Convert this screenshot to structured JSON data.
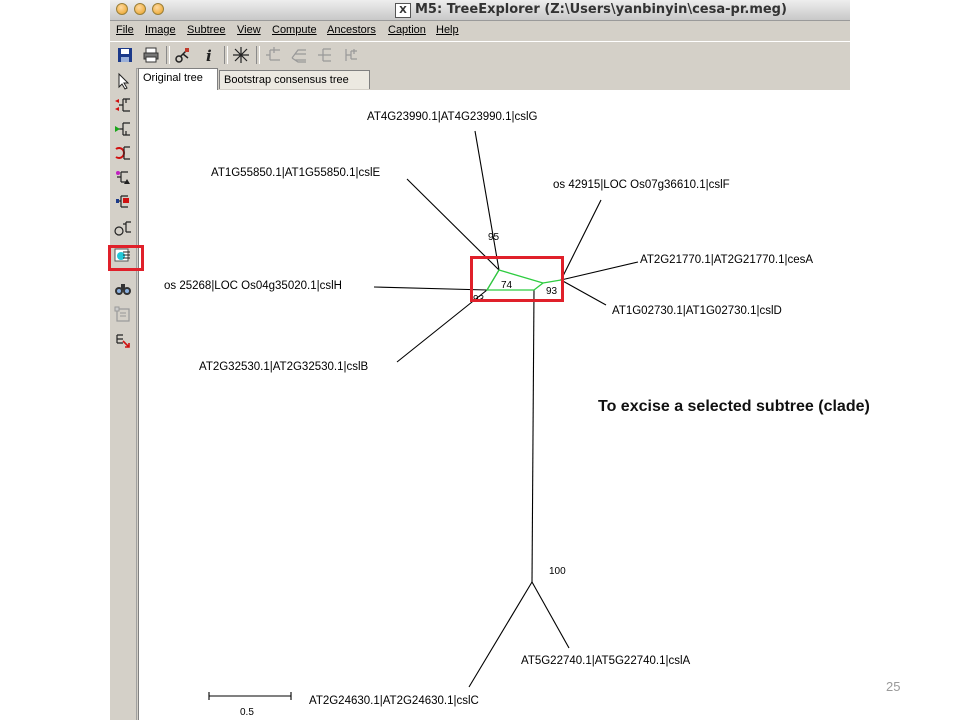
{
  "window": {
    "title": "M5: TreeExplorer (Z:\\Users\\yanbinyin\\cesa-pr.meg)",
    "x_badge": "X"
  },
  "menu": [
    "File",
    "Image",
    "Subtree",
    "View",
    "Compute",
    "Ancestors",
    "Caption",
    "Help"
  ],
  "toolbar_icons": [
    "save-icon",
    "print-icon",
    "cut-icon",
    "info-icon",
    "radiation-tree-icon",
    "rectangular-tree-icon",
    "slanted-tree-icon",
    "straight-tree-icon",
    "circle-tree-icon"
  ],
  "sidebar_icons": [
    "pointer-icon",
    "swap-subtree-icon",
    "flip-subtree-icon",
    "compress-subtree-icon",
    "root-on-branch-icon",
    "place-root-icon",
    "subtree-drawing-icon",
    "excise-subtree-icon",
    "search-icon",
    "properties-icon",
    "shrink-icon"
  ],
  "tabs": [
    {
      "label": "Original tree",
      "active": true
    },
    {
      "label": "Bootstrap consensus tree",
      "active": false
    }
  ],
  "tree": {
    "taxa": {
      "cslG": "AT4G23990.1|AT4G23990.1|cslG",
      "cslE": "AT1G55850.1|AT1G55850.1|cslE",
      "cslF": "os 42915|LOC Os07g36610.1|cslF",
      "cesA": "AT2G21770.1|AT2G21770.1|cesA",
      "cslH": "os 25268|LOC Os04g35020.1|cslH",
      "cslD": "AT1G02730.1|AT1G02730.1|cslD",
      "cslB": "AT2G32530.1|AT2G32530.1|cslB",
      "cslA": "AT5G22740.1|AT5G22740.1|cslA",
      "cslC": "AT2G24630.1|AT2G24630.1|cslC"
    },
    "bootstrap": {
      "n95": "95",
      "n74": "74",
      "n93": "93",
      "n93b": "93",
      "n100": "100"
    },
    "scale_label": "0.5"
  },
  "annotation": "To excise a selected subtree (clade)",
  "page_number": "25",
  "colors": {
    "highlight": "#e0202a",
    "selected_branch": "#2ecc40"
  }
}
